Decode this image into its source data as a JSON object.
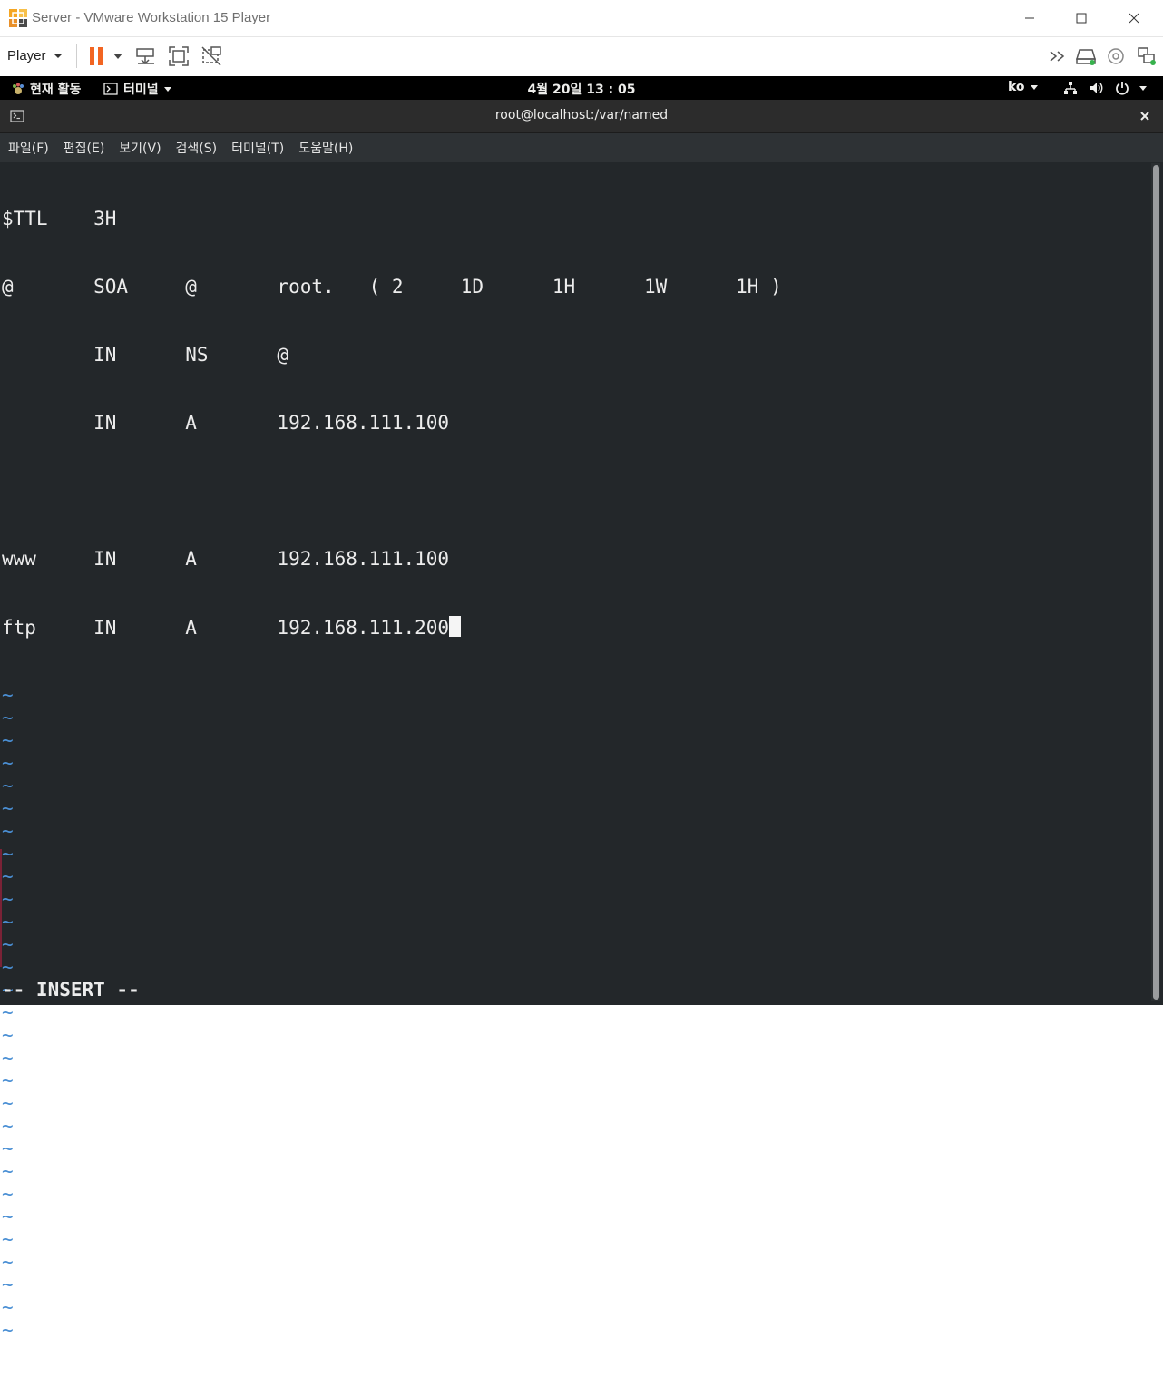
{
  "window": {
    "title": "Server - VMware Workstation 15 Player"
  },
  "toolbar": {
    "player_label": "Player",
    "accent_color": "#f26522"
  },
  "gnome_bar": {
    "activities": "현재 활동",
    "app_menu": "터미널",
    "clock": "4월 20일  13 : 05",
    "language": "ko"
  },
  "terminal": {
    "title": "root@localhost:/var/named",
    "menu": [
      "파일(F)",
      "편집(E)",
      "보기(V)",
      "검색(S)",
      "터미널(T)",
      "도움말(H)"
    ],
    "lines": [
      "$TTL    3H",
      "@       SOA     @       root.   ( 2     1D      1H      1W      1H )",
      "        IN      NS      @",
      "        IN      A       192.168.111.100",
      "",
      "www     IN      A       192.168.111.100",
      "ftp     IN      A       192.168.111.200"
    ],
    "tilde_count": 29,
    "tilde_char": "~",
    "status": "-- INSERT --",
    "background_color": "#23272a",
    "tilde_color": "#4a8fd4"
  }
}
